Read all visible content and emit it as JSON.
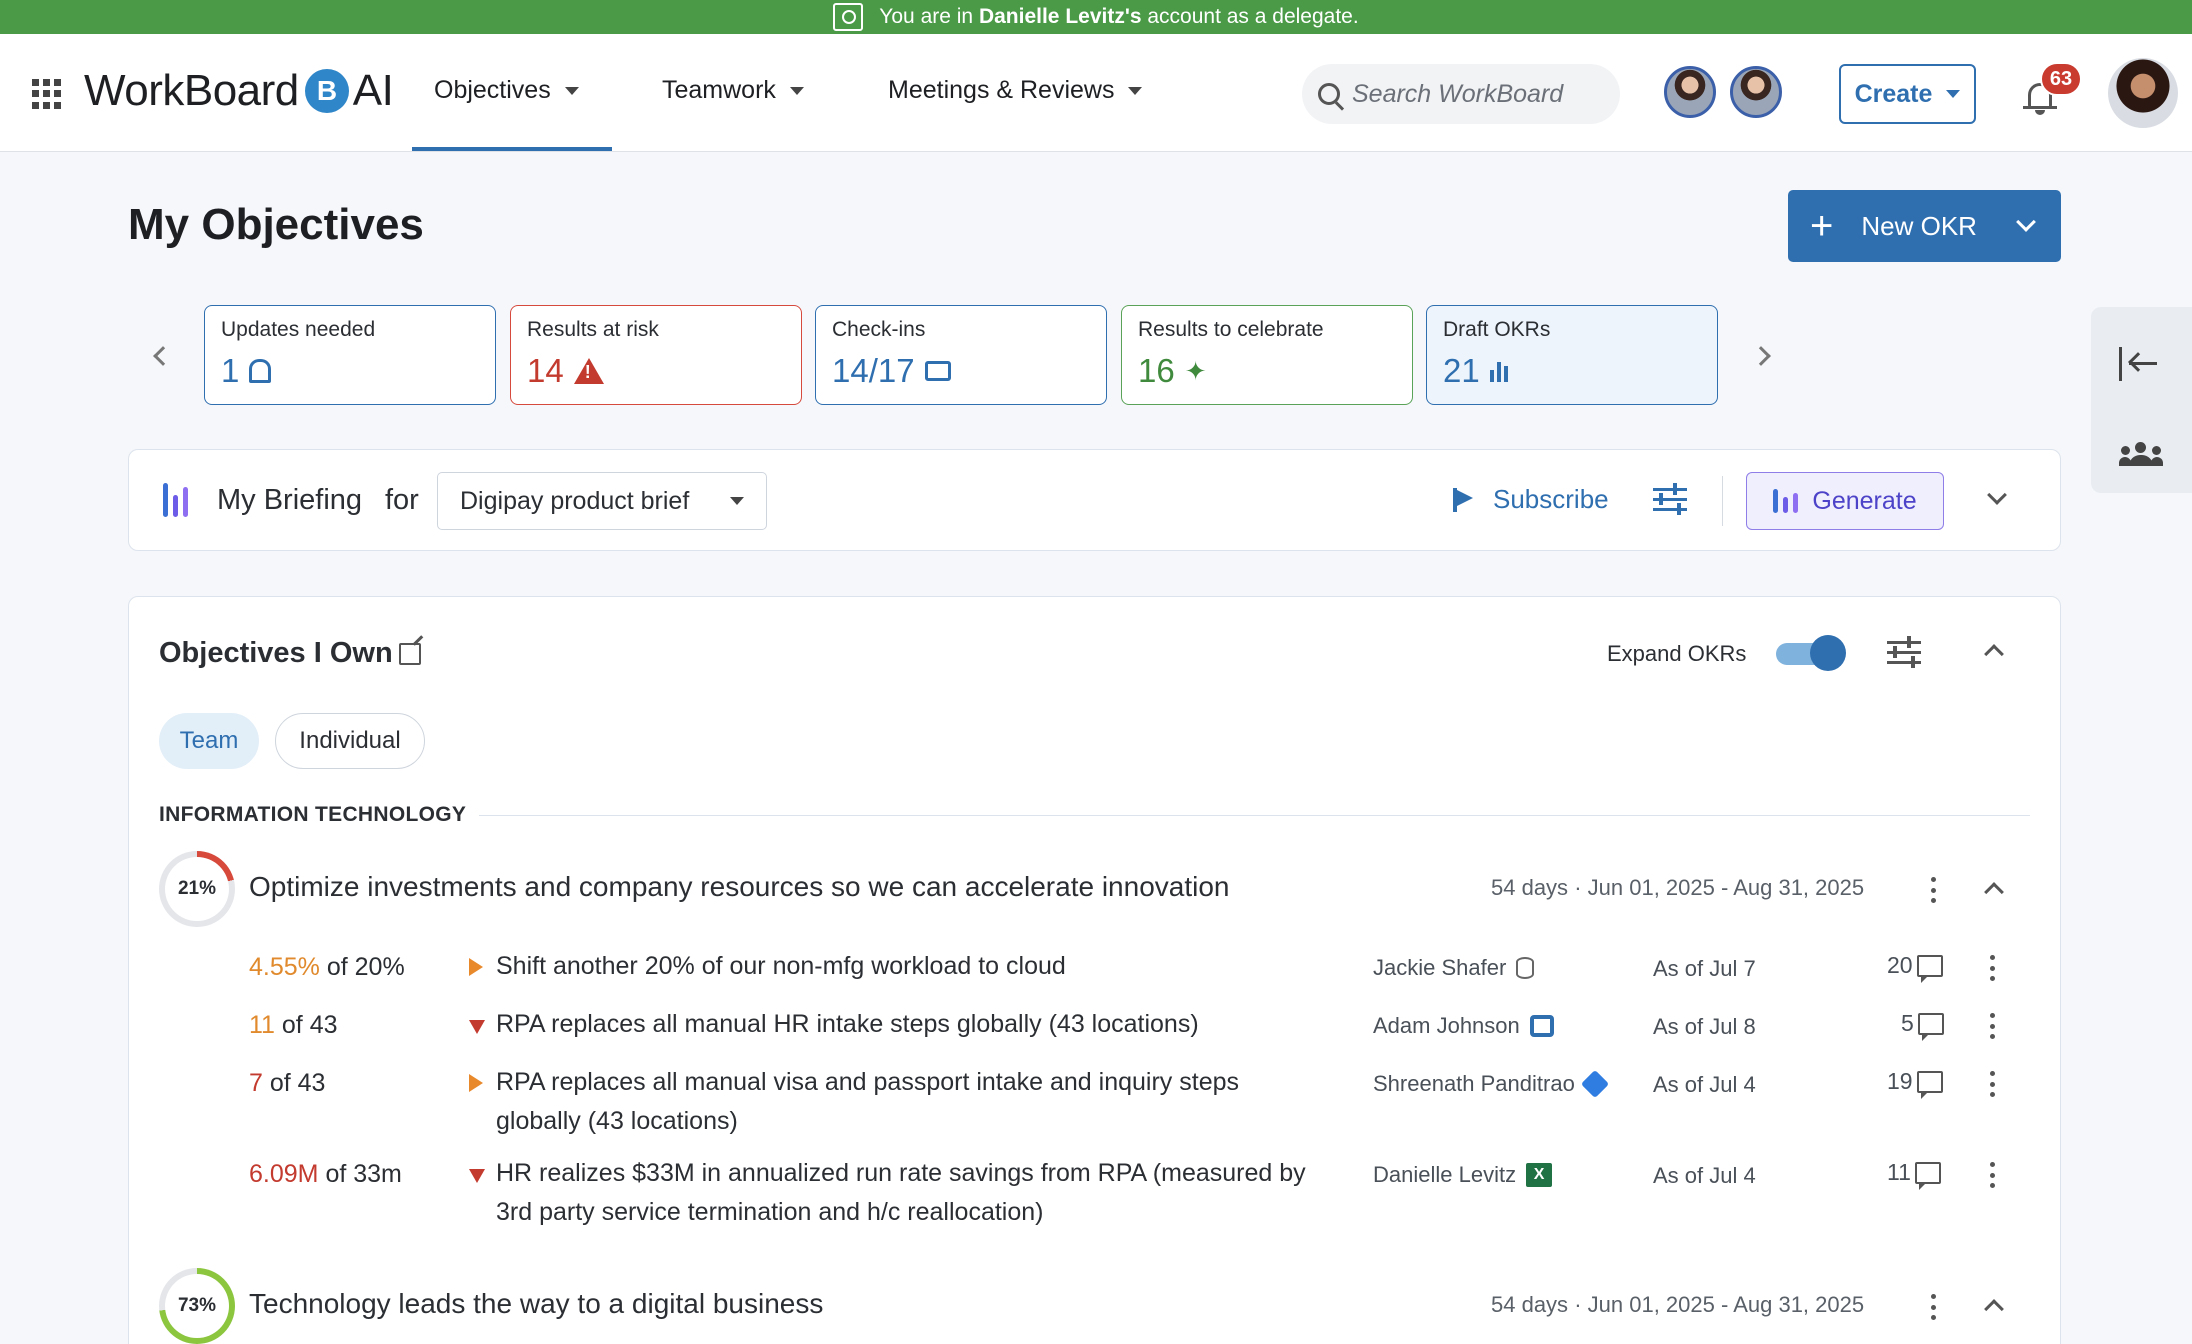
{
  "banner": {
    "prefix": "You are in",
    "account_name": "Danielle Levitz's",
    "suffix": "account as a delegate."
  },
  "header": {
    "logo_text": "WorkBoard",
    "logo_badge": "B",
    "logo_suffix": "AI",
    "nav": [
      {
        "label": "Objectives",
        "active": true
      },
      {
        "label": "Teamwork",
        "active": false
      },
      {
        "label": "Meetings & Reviews",
        "active": false
      }
    ],
    "search_placeholder": "Search WorkBoard",
    "create_label": "Create",
    "notification_count": "63"
  },
  "page": {
    "title": "My Objectives",
    "new_okr_label": "New OKR"
  },
  "stat_cards": [
    {
      "label": "Updates needed",
      "value": "1",
      "icon": "bell-plus-icon",
      "style": "blue"
    },
    {
      "label": "Results at risk",
      "value": "14",
      "icon": "warning-icon",
      "style": "risk"
    },
    {
      "label": "Check-ins",
      "value": "14/17",
      "icon": "chat-icon",
      "style": "blue"
    },
    {
      "label": "Results to celebrate",
      "value": "16",
      "icon": "party-icon",
      "style": "celebrate"
    },
    {
      "label": "Draft OKRs",
      "value": "21",
      "icon": "chart-edit-icon",
      "style": "draft"
    }
  ],
  "briefing": {
    "title": "My Briefing",
    "for_label": "for",
    "selected": "Digipay product brief",
    "subscribe_label": "Subscribe",
    "generate_label": "Generate"
  },
  "objectives_panel": {
    "title": "Objectives I Own",
    "expand_label": "Expand OKRs",
    "expand_on": true,
    "segments": [
      {
        "label": "Team",
        "active": true
      },
      {
        "label": "Individual",
        "active": false
      }
    ],
    "section_label": "INFORMATION TECHNOLOGY",
    "objectives": [
      {
        "progress_label": "21%",
        "progress": 0.21,
        "ring_color": "#d6493b",
        "title": "Optimize investments and company resources so we can accelerate innovation",
        "days": "54 days",
        "dot": "·",
        "dates": "Jun 01, 2025 - Aug 31, 2025",
        "key_results": [
          {
            "current": "4.55%",
            "target": "of 20%",
            "current_color": "orange",
            "status": "right",
            "text": "Shift another 20% of our non-mfg workload to cloud",
            "owner": "Jackie Shafer",
            "source": "database-icon",
            "as_of": "As of Jul 7",
            "comments": "20"
          },
          {
            "current": "11",
            "target": "of 43",
            "current_color": "orange",
            "status": "down",
            "text": "RPA replaces all manual HR intake steps globally (43 locations)",
            "owner": "Adam Johnson",
            "source": "office365-icon",
            "as_of": "As of Jul 8",
            "comments": "5"
          },
          {
            "current": "7",
            "target": "of 43",
            "current_color": "red",
            "status": "right",
            "text": "RPA replaces all manual visa and passport intake and inquiry steps globally (43 locations)",
            "owner": "Shreenath Panditrao",
            "source": "jira-icon",
            "as_of": "As of Jul 4",
            "comments": "19"
          },
          {
            "current": "6.09M",
            "target": "of 33m",
            "current_color": "red",
            "status": "down",
            "text": "HR realizes $33M in annualized run rate savings from RPA (measured by 3rd party service termination and h/c reallocation)",
            "owner": "Danielle Levitz",
            "source": "excel-icon",
            "as_of": "As of Jul 4",
            "comments": "11"
          }
        ]
      },
      {
        "progress_label": "73%",
        "progress": 0.73,
        "ring_color": "#8cc63f",
        "title": "Technology leads the way to a digital business",
        "days": "54 days",
        "dot": "·",
        "dates": "Jun 01, 2025 - Aug 31, 2025"
      }
    ]
  },
  "icons": {
    "excel_letter": "X"
  },
  "colors": {
    "banner": "#4a9a47",
    "primary": "#2f6fb0",
    "risk": "#c33a2e",
    "celebrate": "#3f8a3c",
    "generate": "#4d43c9"
  }
}
